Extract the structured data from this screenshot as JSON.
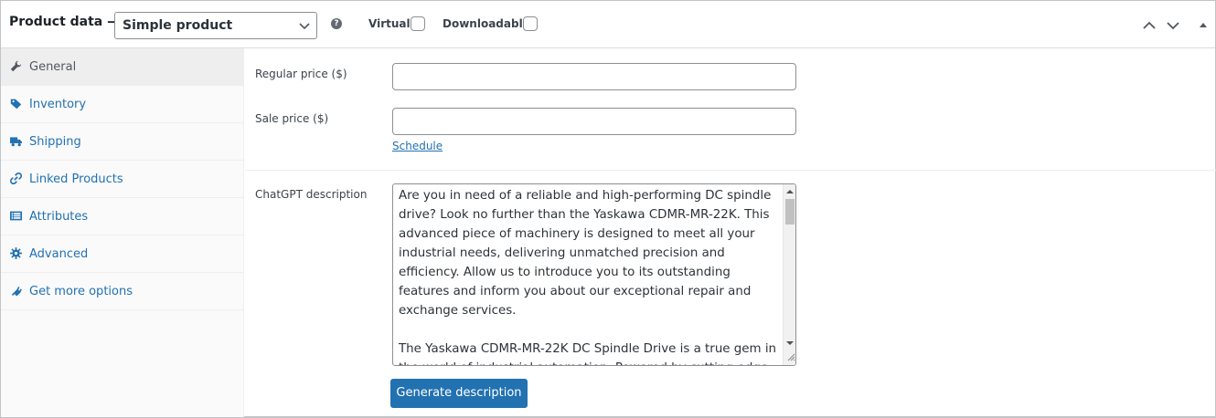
{
  "header": {
    "title": "Product data —",
    "product_type": "Simple product",
    "help_glyph": "?",
    "virtual_label": "Virtual:",
    "downloadable_label": "Downloadable:"
  },
  "sidebar": {
    "items": [
      {
        "label": "General",
        "icon": "wrench-icon",
        "active": true
      },
      {
        "label": "Inventory",
        "icon": "tag-icon",
        "active": false
      },
      {
        "label": "Shipping",
        "icon": "truck-icon",
        "active": false
      },
      {
        "label": "Linked Products",
        "icon": "link-icon",
        "active": false
      },
      {
        "label": "Attributes",
        "icon": "list-icon",
        "active": false
      },
      {
        "label": "Advanced",
        "icon": "gear-icon",
        "active": false
      },
      {
        "label": "Get more options",
        "icon": "plugin-icon",
        "active": false
      }
    ]
  },
  "general": {
    "regular_price_label": "Regular price ($)",
    "regular_price_value": "",
    "sale_price_label": "Sale price ($)",
    "sale_price_value": "",
    "schedule_link": "Schedule",
    "chatgpt_label": "ChatGPT description",
    "chatgpt_text": "Are you in need of a reliable and high-performing DC spindle drive? Look no further than the Yaskawa CDMR-MR-22K. This advanced piece of machinery is designed to meet all your industrial needs, delivering unmatched precision and efficiency. Allow us to introduce you to its outstanding features and inform you about our exceptional repair and exchange services.\n\nThe Yaskawa CDMR-MR-22K DC Spindle Drive is a true gem in the world of industrial automation. Powered by cutting-edge technology, this drive offers remarkable control",
    "generate_button": "Generate description"
  },
  "colors": {
    "accent": "#2271b1",
    "active_tab_bg": "#eeeeee",
    "border": "#8c8f94"
  }
}
